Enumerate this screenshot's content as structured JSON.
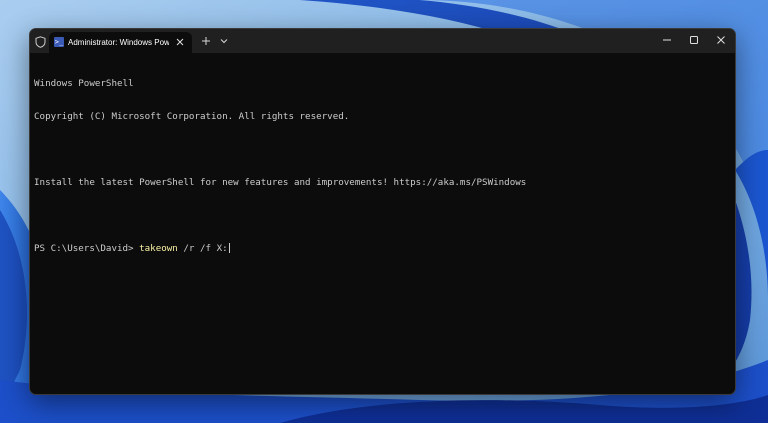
{
  "window": {
    "tab_title": "Administrator: Windows Power",
    "tab_icon_glyph": ">_",
    "new_tab_icon": "plus-icon",
    "dropdown_icon": "chevron-down-icon",
    "minimize_icon": "minimize-icon",
    "maximize_icon": "maximize-icon",
    "close_icon": "close-icon"
  },
  "console": {
    "line1": "Windows PowerShell",
    "line2": "Copyright (C) Microsoft Corporation. All rights reserved.",
    "line3": "",
    "line4": "Install the latest PowerShell for new features and improvements! https://aka.ms/PSWindows",
    "line5": "",
    "prompt": "PS C:\\Users\\David> ",
    "command": "takeown",
    "args": " /r /f X:"
  },
  "colors": {
    "console_background": "#0c0c0c",
    "titlebar_background": "#202020",
    "console_text": "#cccccc",
    "command_highlight": "#f9f1a5",
    "wallpaper_blue": "#1f5fd1"
  }
}
